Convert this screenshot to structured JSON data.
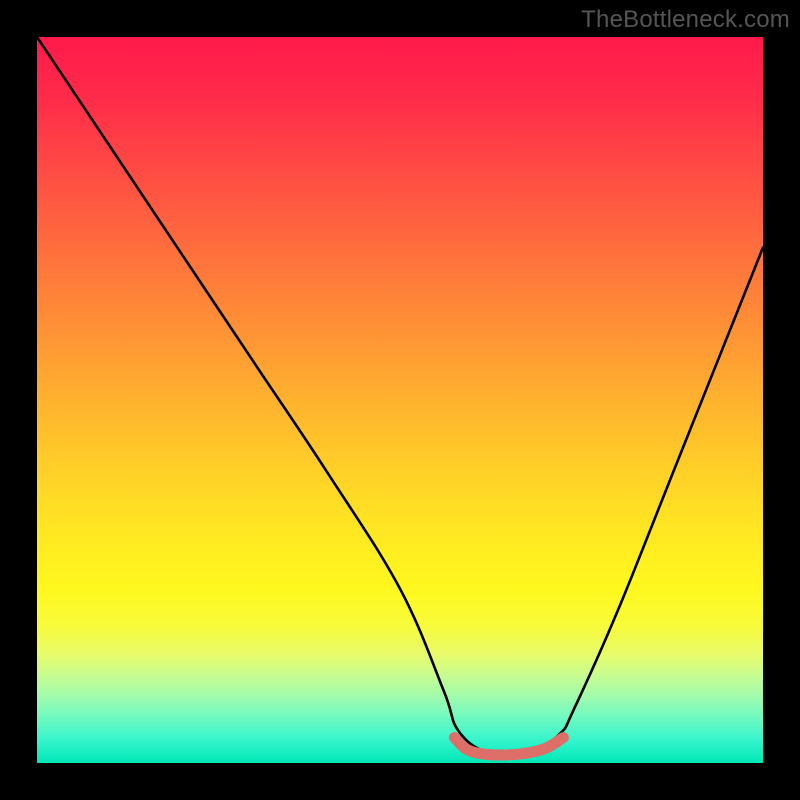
{
  "watermark": "TheBottleneck.com",
  "chart_data": {
    "type": "line",
    "title": "",
    "xlabel": "",
    "ylabel": "",
    "xlim": [
      0,
      100
    ],
    "ylim": [
      0,
      100
    ],
    "grid": false,
    "series": [
      {
        "name": "curve",
        "color": "#000000",
        "x": [
          0,
          10,
          20,
          30,
          40,
          50,
          56,
          58,
          62,
          68,
          72,
          74,
          80,
          88,
          96,
          100
        ],
        "values": [
          100,
          85,
          70,
          55,
          40,
          24,
          10,
          4.5,
          1.5,
          1.5,
          4.0,
          7.5,
          21,
          41,
          61,
          71
        ]
      },
      {
        "name": "flat-base",
        "color": "#dd6e68",
        "x": [
          57.5,
          59,
          61,
          64,
          67,
          70,
          72.5
        ],
        "values": [
          3.5,
          2.0,
          1.3,
          1.1,
          1.3,
          2.0,
          3.5
        ]
      }
    ],
    "gradient_stops": [
      {
        "pos": 0.0,
        "color": "#ff1a4b"
      },
      {
        "pos": 0.18,
        "color": "#ff4a44"
      },
      {
        "pos": 0.38,
        "color": "#ff8a37"
      },
      {
        "pos": 0.58,
        "color": "#ffcb29"
      },
      {
        "pos": 0.76,
        "color": "#fff81e"
      },
      {
        "pos": 0.88,
        "color": "#c7fc90"
      },
      {
        "pos": 1.0,
        "color": "#00e7b5"
      }
    ]
  }
}
